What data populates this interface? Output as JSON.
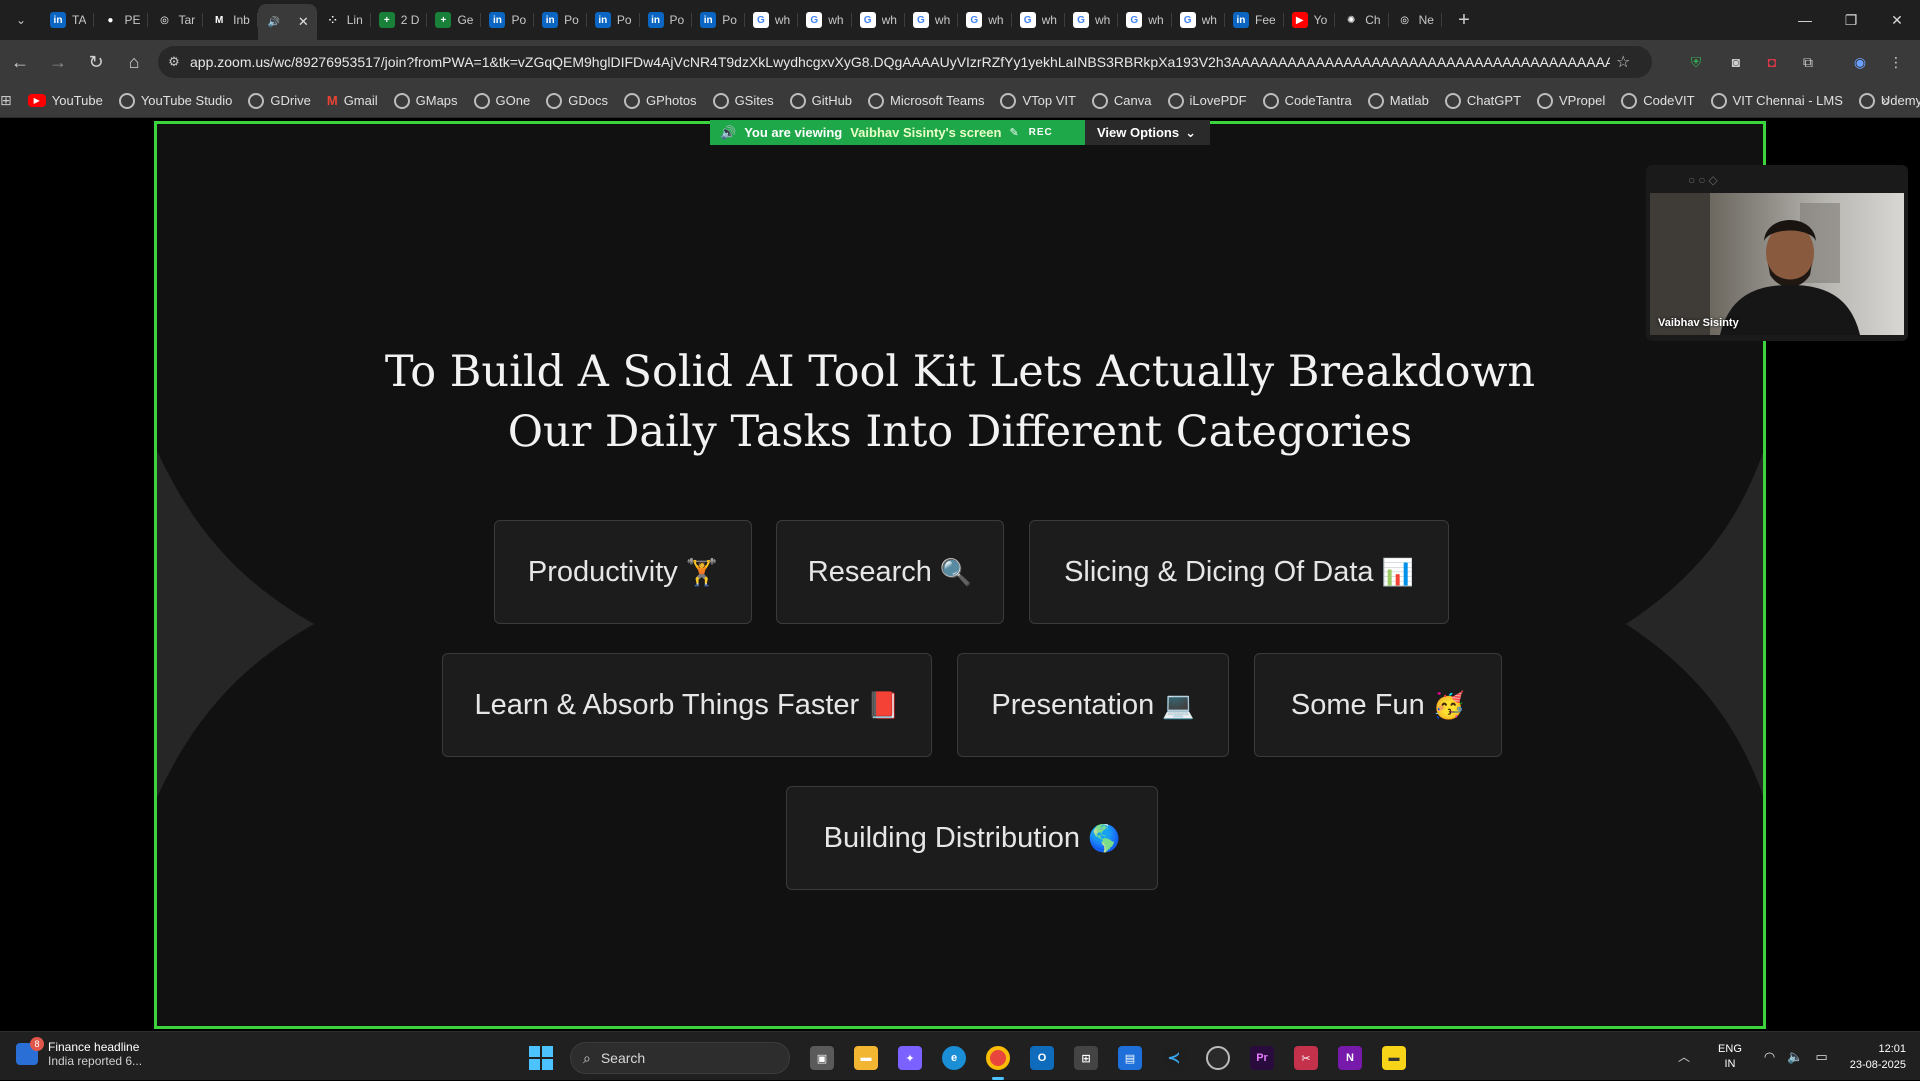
{
  "browser": {
    "tabs": [
      {
        "label": "TA",
        "icon": "linkedin-icon",
        "color": "#0a66c2",
        "glyph": "in"
      },
      {
        "label": "PE",
        "icon": "github-icon",
        "color": "#1f1f1f",
        "glyph": "●"
      },
      {
        "label": "Tar",
        "icon": "globe-icon",
        "color": "#1f1f1f",
        "glyph": "◎"
      },
      {
        "label": "Inb",
        "icon": "gmail-icon",
        "color": "#1f1f1f",
        "glyph": "M"
      },
      {
        "label": "",
        "icon": "audio-icon",
        "color": "#3a3a3a",
        "glyph": "🔊",
        "active": true
      },
      {
        "label": "Lin",
        "icon": "dots-icon",
        "color": "#1f1f1f",
        "glyph": "⁘"
      },
      {
        "label": "2 D",
        "icon": "sheets-icon",
        "color": "#188038",
        "glyph": "+"
      },
      {
        "label": "Ge",
        "icon": "sheets-icon",
        "color": "#188038",
        "glyph": "+"
      },
      {
        "label": "Po",
        "icon": "linkedin-icon",
        "color": "#0a66c2",
        "glyph": "in"
      },
      {
        "label": "Po",
        "icon": "linkedin-icon",
        "color": "#0a66c2",
        "glyph": "in"
      },
      {
        "label": "Po",
        "icon": "linkedin-icon",
        "color": "#0a66c2",
        "glyph": "in"
      },
      {
        "label": "Po",
        "icon": "linkedin-icon",
        "color": "#0a66c2",
        "glyph": "in"
      },
      {
        "label": "Po",
        "icon": "linkedin-icon",
        "color": "#0a66c2",
        "glyph": "in"
      },
      {
        "label": "wh",
        "icon": "google-icon",
        "color": "#ffffff",
        "glyph": "G"
      },
      {
        "label": "wh",
        "icon": "google-icon",
        "color": "#ffffff",
        "glyph": "G"
      },
      {
        "label": "wh",
        "icon": "google-icon",
        "color": "#ffffff",
        "glyph": "G"
      },
      {
        "label": "wh",
        "icon": "google-icon",
        "color": "#ffffff",
        "glyph": "G"
      },
      {
        "label": "wh",
        "icon": "google-icon",
        "color": "#ffffff",
        "glyph": "G"
      },
      {
        "label": "wh",
        "icon": "google-icon",
        "color": "#ffffff",
        "glyph": "G"
      },
      {
        "label": "wh",
        "icon": "google-icon",
        "color": "#ffffff",
        "glyph": "G"
      },
      {
        "label": "wh",
        "icon": "google-icon",
        "color": "#ffffff",
        "glyph": "G"
      },
      {
        "label": "wh",
        "icon": "google-icon",
        "color": "#ffffff",
        "glyph": "G"
      },
      {
        "label": "Fee",
        "icon": "linkedin-icon",
        "color": "#0a66c2",
        "glyph": "in"
      },
      {
        "label": "Yo",
        "icon": "youtube-icon",
        "color": "#ff0000",
        "glyph": "▶"
      },
      {
        "label": "Ch",
        "icon": "chatgpt-icon",
        "color": "#1f1f1f",
        "glyph": "✺"
      },
      {
        "label": "Ne",
        "icon": "globe-icon",
        "color": "#1f1f1f",
        "glyph": "◎"
      }
    ],
    "url": "app.zoom.us/wc/89276953517/join?fromPWA=1&tk=vZGqQEM9hglDIFDw4AjVcNR4T9dzXkLwydhcgxvXyG8.DQgAAAAUyVIzrRZfYy1yekhLaINBS3RBRkpXa193V2h3AAAAAAAAAAAAAAAAAAAAAAAAAAAAAAAAAAAAAAAAAAA&_x_zm_r...",
    "bookmarks": [
      {
        "label": "YouTube",
        "icon": "youtube-icon"
      },
      {
        "label": "YouTube Studio",
        "icon": "globe-icon"
      },
      {
        "label": "GDrive",
        "icon": "globe-icon"
      },
      {
        "label": "Gmail",
        "icon": "gmail-icon"
      },
      {
        "label": "GMaps",
        "icon": "globe-icon"
      },
      {
        "label": "GOne",
        "icon": "globe-icon"
      },
      {
        "label": "GDocs",
        "icon": "globe-icon"
      },
      {
        "label": "GPhotos",
        "icon": "globe-icon"
      },
      {
        "label": "GSites",
        "icon": "globe-icon"
      },
      {
        "label": "GitHub",
        "icon": "github-icon"
      },
      {
        "label": "Microsoft Teams",
        "icon": "globe-icon"
      },
      {
        "label": "VTop VIT",
        "icon": "globe-icon"
      },
      {
        "label": "Canva",
        "icon": "globe-icon"
      },
      {
        "label": "iLovePDF",
        "icon": "globe-icon"
      },
      {
        "label": "CodeTantra",
        "icon": "globe-icon"
      },
      {
        "label": "Matlab",
        "icon": "globe-icon"
      },
      {
        "label": "ChatGPT",
        "icon": "chatgpt-icon"
      },
      {
        "label": "VPropel",
        "icon": "globe-icon"
      },
      {
        "label": "CodeVIT",
        "icon": "globe-icon"
      },
      {
        "label": "VIT Chennai - LMS",
        "icon": "globe-icon"
      },
      {
        "label": "Udemy",
        "icon": "globe-icon"
      }
    ]
  },
  "zoom": {
    "viewing_prefix": "You are viewing",
    "viewing_name": "Vaibhav Sisinty's screen",
    "rec_label": "REC",
    "view_options_label": "View Options",
    "participant_name": "Vaibhav Sisinty",
    "accent_color": "#3cd43c"
  },
  "slide": {
    "title_line1": "To Build A Solid AI Tool Kit Lets Actually Breakdown",
    "title_line2": "Our Daily Tasks Into Different Categories",
    "categories": [
      {
        "label": "Productivity",
        "emoji": "🏋"
      },
      {
        "label": "Research",
        "emoji": "🔍"
      },
      {
        "label": "Slicing & Dicing Of Data",
        "emoji": "📊"
      },
      {
        "label": "Learn & Absorb Things Faster",
        "emoji": "📕"
      },
      {
        "label": "Presentation",
        "emoji": "💻"
      },
      {
        "label": "Some Fun",
        "emoji": "🥳"
      },
      {
        "label": "Building Distribution",
        "emoji": "🌎"
      }
    ]
  },
  "taskbar": {
    "news_headline": "Finance headline",
    "news_sub": "India reported 6...",
    "news_badge": "8",
    "search_label": "Search",
    "lang_line1": "ENG",
    "lang_line2": "IN",
    "time": "12:01",
    "date": "23-08-2025"
  }
}
